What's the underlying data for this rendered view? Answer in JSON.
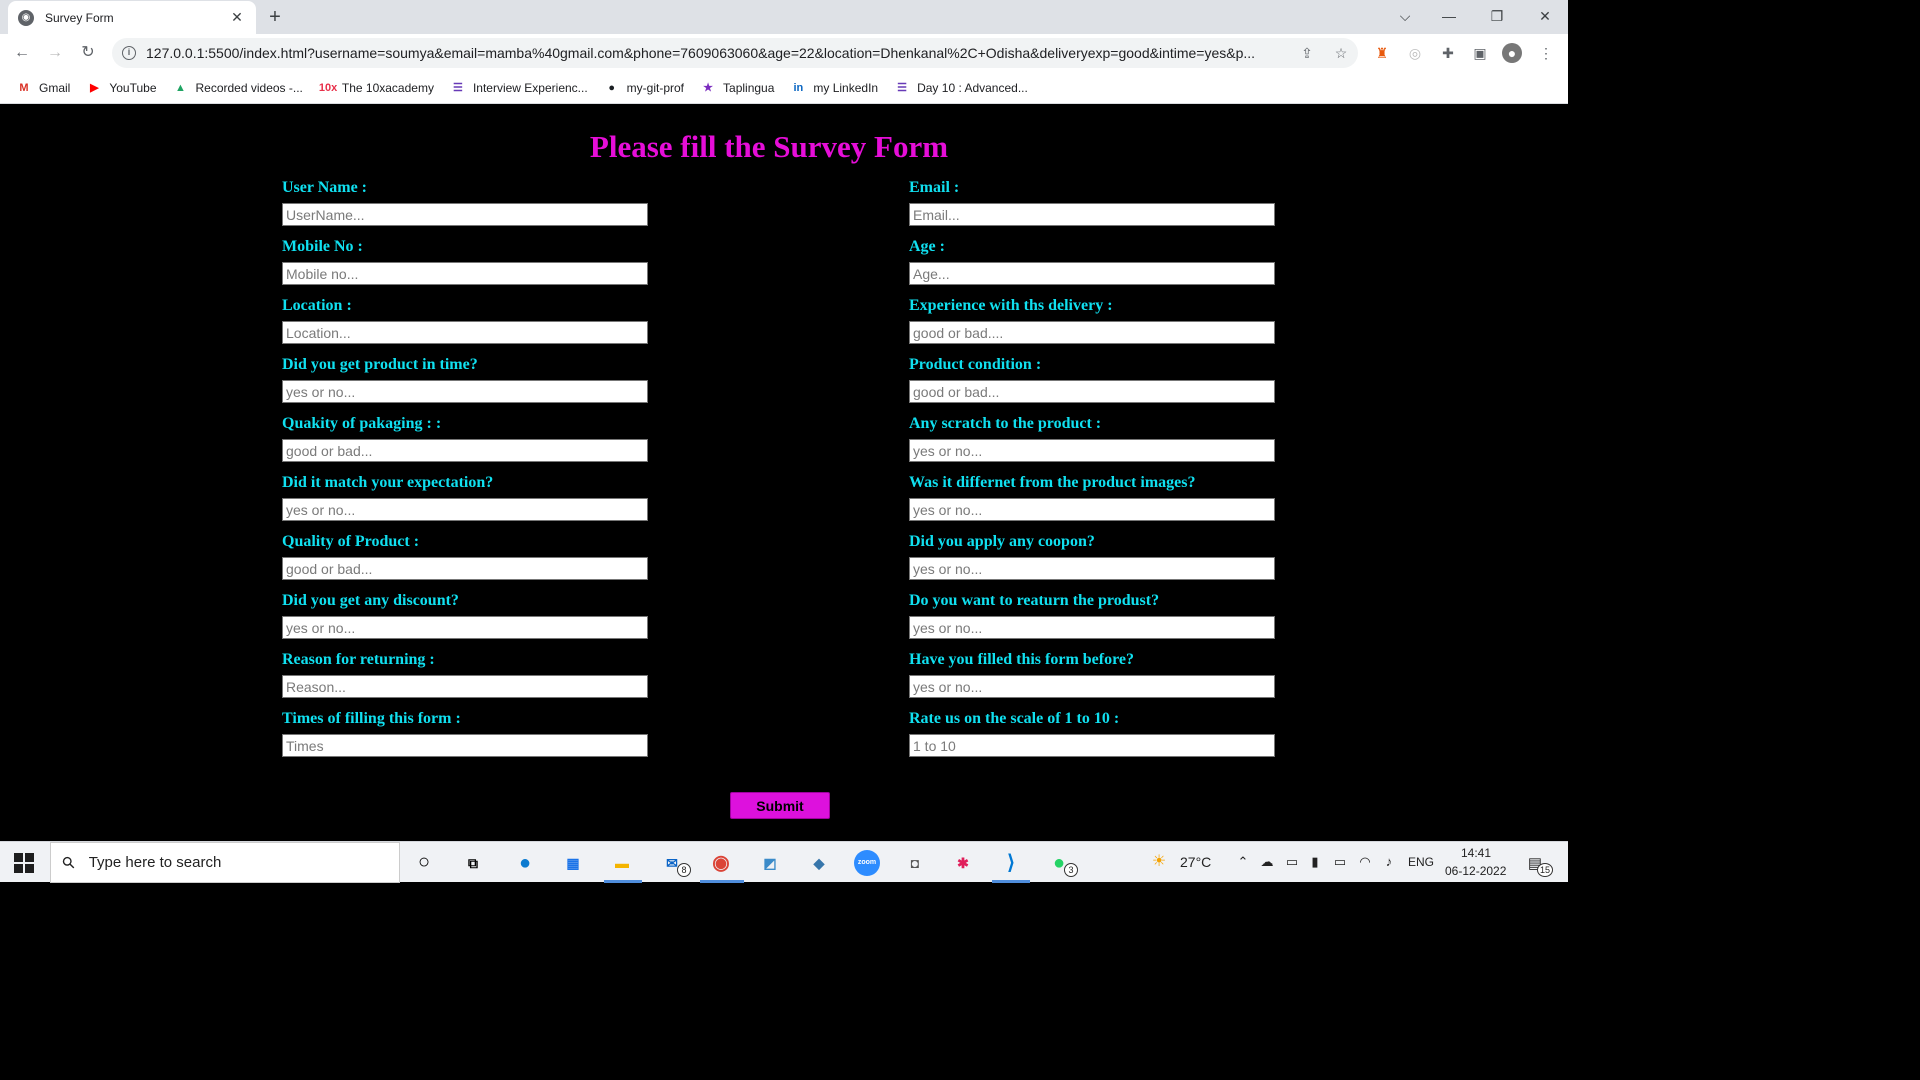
{
  "browser": {
    "tab_title": "Survey Form",
    "tab_close": "✕",
    "new_tab": "+",
    "url": "127.0.0.1:5500/index.html?username=soumya&email=mamba%40gmail.com&phone=7609063060&age=22&location=Dhenkanal%2C+Odisha&deliveryexp=good&intime=yes&p...",
    "window_controls": [
      "⌵",
      "—",
      "❐",
      "✕"
    ],
    "bookmarks": [
      {
        "icon": "gmail-icon",
        "glyph": "M",
        "color": "#d93025",
        "label": "Gmail"
      },
      {
        "icon": "youtube-icon",
        "glyph": "▶",
        "color": "#ff0000",
        "label": "YouTube"
      },
      {
        "icon": "drive-icon",
        "glyph": "▲",
        "color": "#1fa463",
        "label": "Recorded videos -..."
      },
      {
        "icon": "10x-icon",
        "glyph": "10x",
        "color": "#e8304a",
        "label": "The 10xacademy"
      },
      {
        "icon": "forms-icon",
        "glyph": "☰",
        "color": "#673ab7",
        "label": "Interview Experienc..."
      },
      {
        "icon": "github-icon",
        "glyph": "●",
        "color": "#1b1f23",
        "label": "my-git-prof"
      },
      {
        "icon": "taplingua-icon",
        "glyph": "★",
        "color": "#7b2cbf",
        "label": "Taplingua"
      },
      {
        "icon": "linkedin-icon",
        "glyph": "in",
        "color": "#0a66c2",
        "label": "my LinkedIn"
      },
      {
        "icon": "forms-icon",
        "glyph": "☰",
        "color": "#673ab7",
        "label": "Day 10 : Advanced..."
      }
    ]
  },
  "form": {
    "heading": "Please fill the Survey Form",
    "left_fields": [
      {
        "label": "User Name :",
        "placeholder": "UserName..."
      },
      {
        "label": "Mobile No :",
        "placeholder": "Mobile no..."
      },
      {
        "label": "Location :",
        "placeholder": "Location..."
      },
      {
        "label": "Did you get product in time?",
        "placeholder": "yes or no..."
      },
      {
        "label": "Quakity of pakaging : :",
        "placeholder": "good or bad..."
      },
      {
        "label": "Did it match your expectation?",
        "placeholder": "yes or no..."
      },
      {
        "label": "Quality of Product :",
        "placeholder": "good or bad..."
      },
      {
        "label": "Did you get any discount?",
        "placeholder": "yes or no..."
      },
      {
        "label": "Reason for returning :",
        "placeholder": "Reason..."
      },
      {
        "label": "Times of filling this form :",
        "placeholder": "Times"
      }
    ],
    "right_fields": [
      {
        "label": "Email :",
        "placeholder": "Email..."
      },
      {
        "label": "Age :",
        "placeholder": "Age..."
      },
      {
        "label": "Experience with ths delivery :",
        "placeholder": "good or bad...."
      },
      {
        "label": "Product condition :",
        "placeholder": "good or bad..."
      },
      {
        "label": "Any scratch to the product :",
        "placeholder": "yes or no..."
      },
      {
        "label": "Was it differnet from the product images?",
        "placeholder": "yes or no..."
      },
      {
        "label": "Did you apply any coopon?",
        "placeholder": "yes or no..."
      },
      {
        "label": "Do you want to reaturn the produst?",
        "placeholder": "yes or no..."
      },
      {
        "label": "Have you filled this form before?",
        "placeholder": "yes or no..."
      },
      {
        "label": "Rate us on the scale of 1 to 10 :",
        "placeholder": "1 to 10"
      }
    ],
    "submit_label": "Submit",
    "colors": {
      "heading": "#e60ed8",
      "label": "#10e0f0",
      "submit": "#dd11dd",
      "background": "#000000"
    }
  },
  "taskbar": {
    "search_placeholder": "Type here to search",
    "weather": "27°C",
    "language": "ENG",
    "time": "14:41",
    "date": "06-12-2022",
    "mail_badge": "8",
    "whatsapp_badge": "3",
    "notification_count": "15"
  }
}
